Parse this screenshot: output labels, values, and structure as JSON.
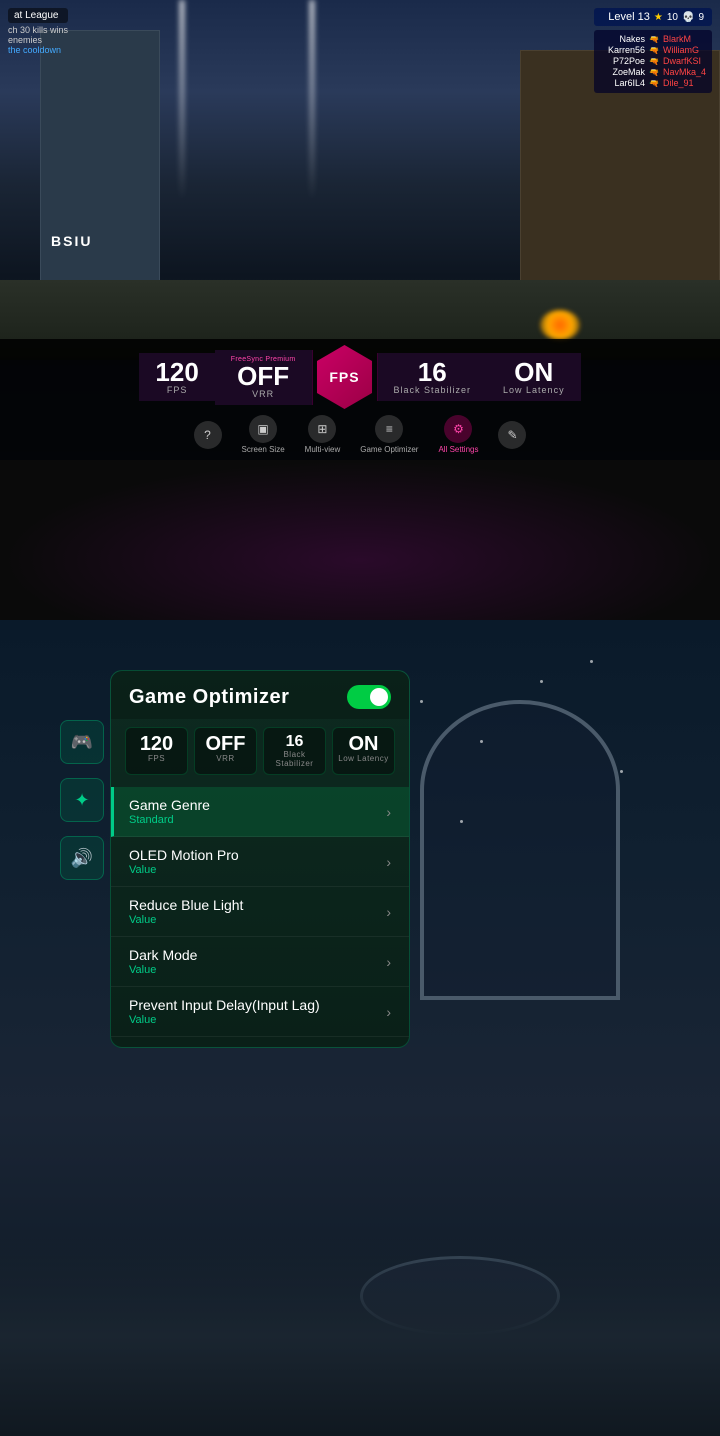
{
  "top_game": {
    "hud": {
      "league": "at League",
      "kills_text": "ch 30 kills wins",
      "enemies_text": "enemies",
      "cooldown_text": "the cooldown",
      "level": "Level 13",
      "star_count": "10",
      "skull_count": "9"
    },
    "scoreboard": {
      "players": [
        {
          "name": "Nakes",
          "gun": "⊢",
          "enemy": "BlarkM"
        },
        {
          "name": "Karren56",
          "gun": "⊢",
          "enemy": "WilliamG"
        },
        {
          "name": "P72Poe",
          "gun": "⊢",
          "enemy": "DwarfKSI"
        },
        {
          "name": "ZoeMak",
          "gun": "⊢",
          "enemy": "NavMka_4"
        },
        {
          "name": "Lar6IL4",
          "gun": "⊢",
          "enemy": "Dile_91"
        }
      ]
    },
    "stats": {
      "fps_value": "120",
      "fps_label": "FPS",
      "vrr_value": "OFF",
      "vrr_label": "VRR",
      "vrr_sublabel": "FreeSync Premium",
      "center_label": "FPS",
      "stabilizer_value": "16",
      "stabilizer_label": "Black Stabilizer",
      "latency_value": "ON",
      "latency_label": "Low Latency"
    },
    "controls": {
      "help_label": "?",
      "screen_size_label": "Screen Size",
      "multiview_label": "Multi-view",
      "game_optimizer_label": "Game Optimizer",
      "all_settings_label": "All Settings"
    }
  },
  "bottom_game": {
    "optimizer": {
      "title": "Game Optimizer",
      "toggle_state": "on",
      "stats": [
        {
          "value": "120",
          "label": "FPS"
        },
        {
          "value": "OFF",
          "label": "VRR"
        },
        {
          "value": "16",
          "label": "Black Stabilizer"
        },
        {
          "value": "ON",
          "label": "Low Latency"
        }
      ],
      "menu_items": [
        {
          "title": "Game Genre",
          "value": "Standard",
          "active": true
        },
        {
          "title": "OLED Motion Pro",
          "value": "Value",
          "active": false
        },
        {
          "title": "Reduce Blue Light",
          "value": "Value",
          "active": false
        },
        {
          "title": "Dark Mode",
          "value": "Value",
          "active": false
        },
        {
          "title": "Prevent Input Delay(Input Lag)",
          "value": "Value",
          "active": false
        }
      ]
    },
    "side_icons": [
      {
        "icon": "🎮",
        "name": "gamepad"
      },
      {
        "icon": "✦",
        "name": "display"
      },
      {
        "icon": "🔊",
        "name": "audio"
      }
    ]
  },
  "colors": {
    "accent_green": "#00cc88",
    "accent_pink": "#cc0066",
    "bg_dark": "#0a0a0a",
    "panel_bg": "#0d2a20",
    "toggle_green": "#00cc44"
  }
}
